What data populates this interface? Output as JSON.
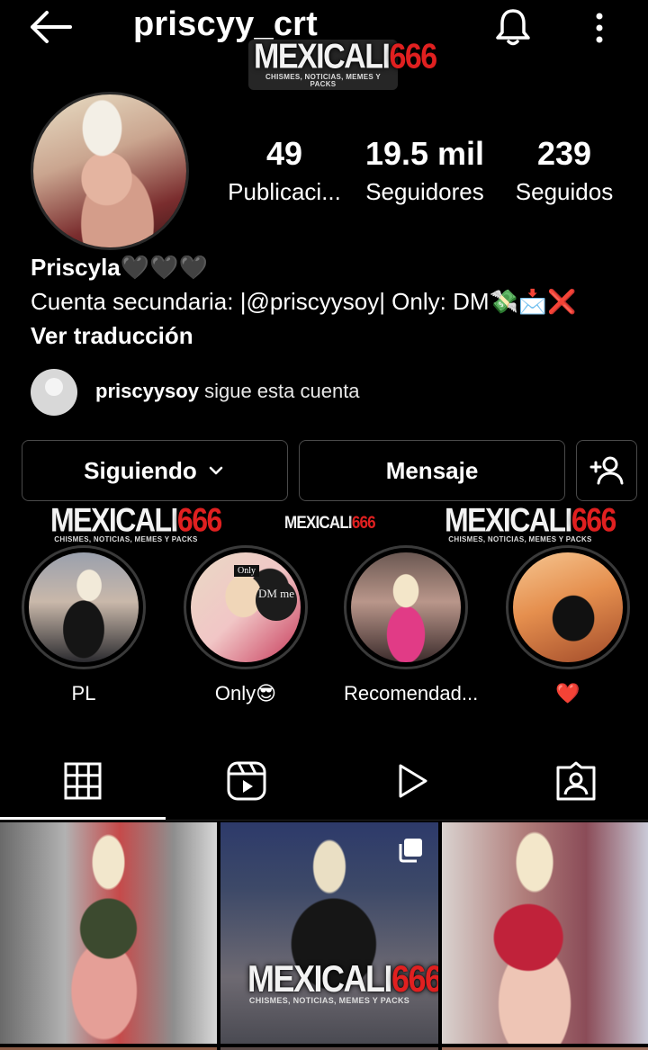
{
  "header": {
    "username": "priscyy_crt"
  },
  "watermark": {
    "brand_text": "MEXICALI",
    "brand_number": "666",
    "tagline": "CHISMES, NOTICIAS, MEMES Y PACKS"
  },
  "stats": [
    {
      "value": "49",
      "label": "Publicaci..."
    },
    {
      "value": "19.5 mil",
      "label": "Seguidores"
    },
    {
      "value": "239",
      "label": "Seguidos"
    }
  ],
  "bio": {
    "name": "Priscyla",
    "name_emojis": "🖤🖤🖤",
    "line": "Cuenta secundaria: |@priscyysoy| Only:  DM",
    "line_emojis": "💸📩❌",
    "translate": "Ver traducción"
  },
  "followed_by": {
    "user": "priscyysoy",
    "text": " sigue esta cuenta"
  },
  "buttons": {
    "following": "Siguiendo",
    "message": "Mensaje"
  },
  "highlights": [
    {
      "label": "PL"
    },
    {
      "label": "Only😎",
      "badge_top": "Only",
      "badge_circle": "DM me"
    },
    {
      "label": "Recomendad..."
    },
    {
      "label": "❤️"
    }
  ],
  "tabs": [
    {
      "name": "posts",
      "icon": "grid-icon",
      "active": true
    },
    {
      "name": "reels",
      "icon": "reels-icon",
      "active": false
    },
    {
      "name": "videos",
      "icon": "play-icon",
      "active": false
    },
    {
      "name": "tagged",
      "icon": "tagged-person-icon",
      "active": false
    }
  ],
  "colors": {
    "background": "#000000",
    "text": "#ffffff",
    "border": "#4a4a4a",
    "watermark_red": "#e02020"
  }
}
